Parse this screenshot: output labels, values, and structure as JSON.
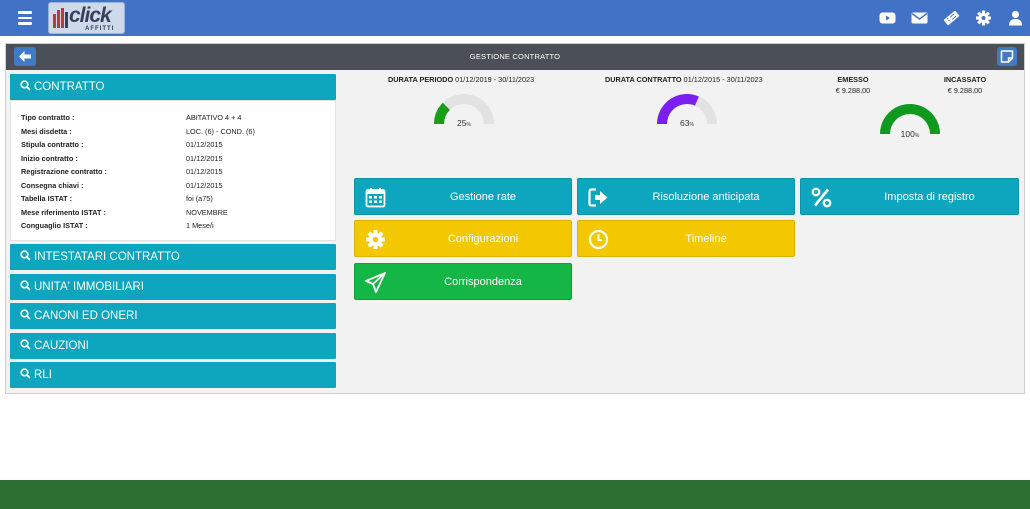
{
  "header": {
    "logo_text": "click",
    "logo_subtext": "AFFITTI",
    "icons": [
      "youtube-icon",
      "mail-icon",
      "ticket-icon",
      "gear-icon",
      "user-icon"
    ]
  },
  "panel": {
    "title": "GESTIONE CONTRATTO"
  },
  "sections": {
    "contratto": "CONTRATTO",
    "intestatari": "INTESTATARI CONTRATTO",
    "unita": "UNITA' IMMOBILIARI",
    "canoni": "CANONI ED ONERI",
    "cauzioni": "CAUZIONI",
    "rli": "RLI"
  },
  "contract_details": [
    {
      "label": "Tipo contratto :",
      "value": "ABITATIVO 4 + 4"
    },
    {
      "label": "Mesi disdetta :",
      "value": "LOC. (6) - COND. (6)"
    },
    {
      "label": "Stipula contratto :",
      "value": "01/12/2015"
    },
    {
      "label": "Inizio contratto :",
      "value": "01/12/2015"
    },
    {
      "label": "Registrazione contratto :",
      "value": "01/12/2015"
    },
    {
      "label": "Consegna chiavi :",
      "value": "01/12/2015"
    },
    {
      "label": "Tabella ISTAT :",
      "value": "foi (a75)"
    },
    {
      "label": "Mese riferimento ISTAT :",
      "value": "NOVEMBRE"
    },
    {
      "label": "Conguaglio ISTAT :",
      "value": "1 Mese/i"
    }
  ],
  "gauges": {
    "periodo": {
      "label": "DURATA PERIODO",
      "range": "01/12/2019 - 30/11/2023",
      "percent": 25,
      "pct_text": "25",
      "color": "#1a9e1a"
    },
    "contratto": {
      "label": "DURATA CONTRATTO",
      "range": "01/12/2015 - 30/11/2023",
      "percent": 63,
      "pct_text": "63",
      "color": "#7a1ff0"
    },
    "incassato": {
      "percent": 100,
      "pct_text": "100",
      "color": "#0f9a1f"
    },
    "pct_suffix": "%"
  },
  "money": {
    "emesso_label": "EMESSO",
    "emesso_value": "€ 9.288,00",
    "incassato_label": "INCASSATO",
    "incassato_value": "€ 9.288,00"
  },
  "actions": {
    "gestione_rate": "Gestione rate",
    "risoluzione": "Risoluzione anticipata",
    "imposta": "Imposta di registro",
    "configurazioni": "Configurazioni",
    "timeline": "Timeline",
    "corrispondenza": "Corrispondenza"
  },
  "colors": {
    "navbar": "#4272c6",
    "teal": "#0ea6be",
    "yellow": "#f4c800",
    "green": "#14b746",
    "footer": "#2d6e33"
  }
}
